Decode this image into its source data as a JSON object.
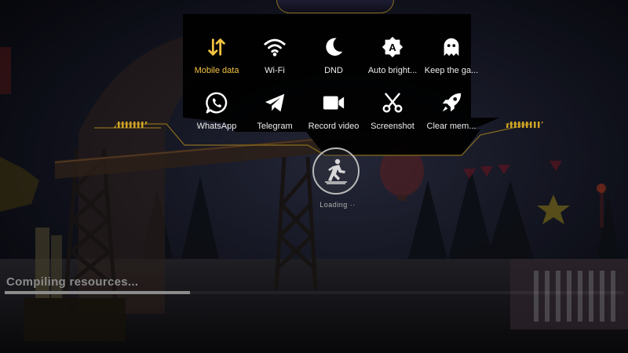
{
  "quick_panel": {
    "tiles": [
      {
        "id": "mobile-data",
        "label": "Mobile data",
        "icon": "mobile-data-arrows-icon",
        "active": true
      },
      {
        "id": "wifi",
        "label": "Wi-Fi",
        "icon": "wifi-icon",
        "active": false
      },
      {
        "id": "dnd",
        "label": "DND",
        "icon": "moon-icon",
        "active": false
      },
      {
        "id": "auto-brightness",
        "label": "Auto bright...",
        "icon": "auto-brightness-icon",
        "active": false
      },
      {
        "id": "keep-game",
        "label": "Keep the ga...",
        "icon": "ghost-icon",
        "active": false
      },
      {
        "id": "whatsapp",
        "label": "WhatsApp",
        "icon": "whatsapp-icon",
        "active": false
      },
      {
        "id": "telegram",
        "label": "Telegram",
        "icon": "telegram-icon",
        "active": false
      },
      {
        "id": "record-video",
        "label": "Record video",
        "icon": "video-camera-icon",
        "active": false
      },
      {
        "id": "screenshot",
        "label": "Screenshot",
        "icon": "scissors-icon",
        "active": false
      },
      {
        "id": "clear-memory",
        "label": "Clear mem...",
        "icon": "rocket-icon",
        "active": false
      }
    ]
  },
  "game": {
    "loading_label": "Loading ··",
    "status_text": "Compiling resources...",
    "progress": 0.3
  },
  "colors": {
    "accent_gold": "#f2c340",
    "panel_bg": "#000000",
    "panel_border": "#8a6d1f",
    "label_text": "#ececec"
  }
}
